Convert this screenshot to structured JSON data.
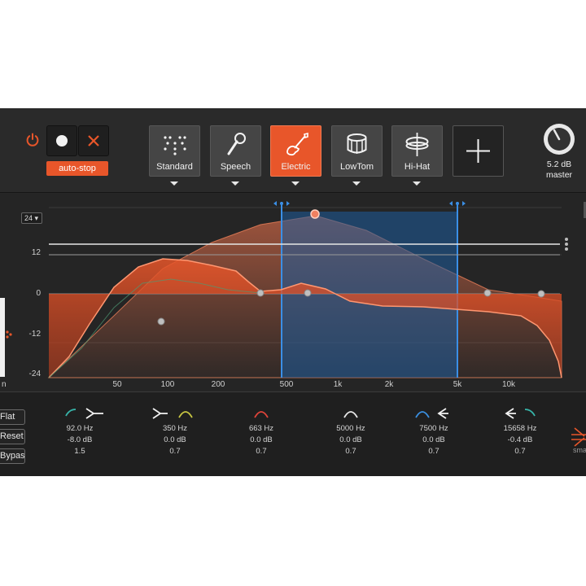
{
  "header": {
    "autostop_label": "auto-stop",
    "presets": [
      {
        "label": "Standard",
        "icon": "dots-icon",
        "active": false
      },
      {
        "label": "Speech",
        "icon": "microphone-icon",
        "active": false
      },
      {
        "label": "Electric",
        "icon": "electric-guitar-icon",
        "active": true
      },
      {
        "label": "LowTom",
        "icon": "drum-icon",
        "active": false
      },
      {
        "label": "Hi-Hat",
        "icon": "hi-hat-icon",
        "active": false
      }
    ],
    "master": {
      "value": "5.2 dB",
      "label": "master"
    }
  },
  "graph": {
    "range_select": "24 ▾",
    "y_labels": [
      "24",
      "12",
      "0",
      "-12",
      "-24"
    ],
    "x_labels": [
      "50",
      "100",
      "200",
      "500",
      "1k",
      "2k",
      "5k",
      "10k"
    ],
    "left_edge_label": "n",
    "selection": {
      "from_hz": 500,
      "to_hz": 5000
    }
  },
  "side_buttons": [
    "Flat",
    "Reset",
    "Bypass"
  ],
  "bands": [
    {
      "freq": "92.0 Hz",
      "gain": "-8.0 dB",
      "q": "1.5",
      "color": "#37b3a8",
      "shape": "lowshelf"
    },
    {
      "freq": "350 Hz",
      "gain": "0.0 dB",
      "q": "0.7",
      "color": "#c8c642",
      "shape": "bell"
    },
    {
      "freq": "663 Hz",
      "gain": "0.0 dB",
      "q": "0.7",
      "color": "#e0443a",
      "shape": "bell"
    },
    {
      "freq": "5000 Hz",
      "gain": "0.0 dB",
      "q": "0.7",
      "color": "#e8e8e8",
      "shape": "bell"
    },
    {
      "freq": "7500 Hz",
      "gain": "0.0 dB",
      "q": "0.7",
      "color": "#3a8fe0",
      "shape": "bell"
    },
    {
      "freq": "15658 Hz",
      "gain": "-0.4 dB",
      "q": "0.7",
      "color": "#37b3a8",
      "shape": "highshelf"
    }
  ],
  "logo_text": "smart"
}
